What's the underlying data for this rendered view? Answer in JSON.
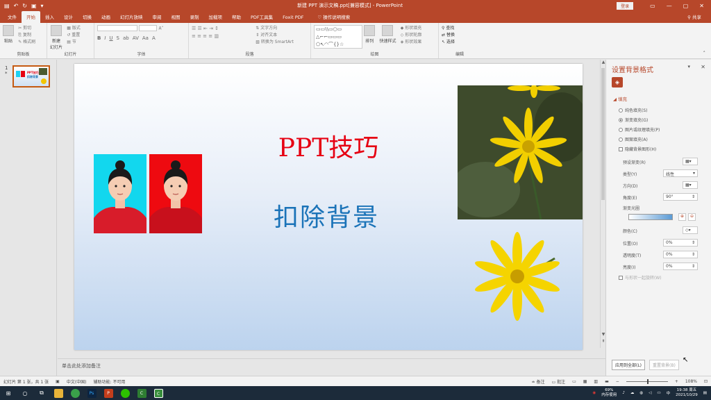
{
  "titlebar": {
    "title": "新建 PPT 演示文稿.ppt[兼容模式] - PowerPoint",
    "login": "登录",
    "win_min": "—",
    "win_restore": "▢",
    "win_max": "▢",
    "win_close": "✕"
  },
  "menu": {
    "tabs": [
      "文件",
      "开始",
      "插入",
      "设计",
      "切换",
      "动画",
      "幻灯片放映",
      "审阅",
      "视图",
      "录制",
      "加载项",
      "帮助",
      "PDF工具集",
      "Foxit PDF"
    ],
    "active": "开始",
    "tell_me": "操作说明搜索",
    "share": "共享"
  },
  "ribbon": {
    "clipboard": {
      "label": "剪贴板",
      "paste": "粘贴",
      "cut": "剪切",
      "copy": "复制",
      "format_painter": "格式刷"
    },
    "slides": {
      "label": "幻灯片",
      "new_slide": "新建\n幻灯片",
      "layout": "版式",
      "reset": "重置",
      "section": "节"
    },
    "font": {
      "label": "字体",
      "bold": "B",
      "italic": "I",
      "underline": "U",
      "strike": "S",
      "shadow": "ab",
      "spacing": "AV",
      "case": "Aa",
      "color": "A"
    },
    "paragraph": {
      "label": "段落",
      "text_direction": "文字方向",
      "align_text": "对齐文本",
      "smartart": "转换为 SmartArt"
    },
    "drawing": {
      "label": "绘图",
      "arrange": "排列",
      "quick_styles": "快速样式",
      "shape_fill": "形状填充",
      "shape_outline": "形状轮廓",
      "shape_effects": "形状效果"
    },
    "editing": {
      "label": "编辑",
      "find": "查找",
      "replace": "替换",
      "select": "选择"
    }
  },
  "thumbnails": [
    {
      "number": "1",
      "star": "*",
      "title": "PPT技巧",
      "subtitle": "扣除背景"
    }
  ],
  "slide": {
    "title": "PPT技巧",
    "subtitle": "扣除背景",
    "colors": {
      "title": "#e60012",
      "subtitle": "#1a73b8",
      "photo1_bg": "#12d7ee",
      "photo2_bg": "#ee0a10"
    }
  },
  "notes": {
    "placeholder": "单击此处添加备注"
  },
  "format_pane": {
    "title": "设置背景格式",
    "section": "填充",
    "fill_options": [
      {
        "label": "纯色填充(S)",
        "selected": false
      },
      {
        "label": "渐变填充(G)",
        "selected": true
      },
      {
        "label": "图片或纹理填充(P)",
        "selected": false
      },
      {
        "label": "图案填充(A)",
        "selected": false
      }
    ],
    "hide_background": "隐藏背景图形(H)",
    "preset_gradient": "预设渐变(R)",
    "type_label": "类型(Y)",
    "type_value": "线性",
    "direction_label": "方向(D)",
    "angle_label": "角度(E)",
    "angle_value": "90°",
    "stops_label": "渐变光圈",
    "color_label": "颜色(C)",
    "position_label": "位置(O)",
    "position_value": "0%",
    "transparency_label": "透明度(T)",
    "transparency_value": "0%",
    "brightness_label": "亮度(I)",
    "brightness_value": "0%",
    "rotate_with_shape": "与形状一起旋转(W)",
    "apply_all": "应用到全部(L)",
    "reset_bg": "重置背景(B)"
  },
  "statusbar": {
    "slide_info": "幻灯片 第 1 张，共 1 张",
    "language": "中文(中国)",
    "accessibility": "辅助功能: 不可用",
    "notes": "备注",
    "comments": "批注",
    "zoom": "108%"
  },
  "taskbar": {
    "time": "19:38 周五",
    "date": "2021/10/29",
    "mem": "69%",
    "mem_label": "内存使用",
    "lang": "中"
  }
}
